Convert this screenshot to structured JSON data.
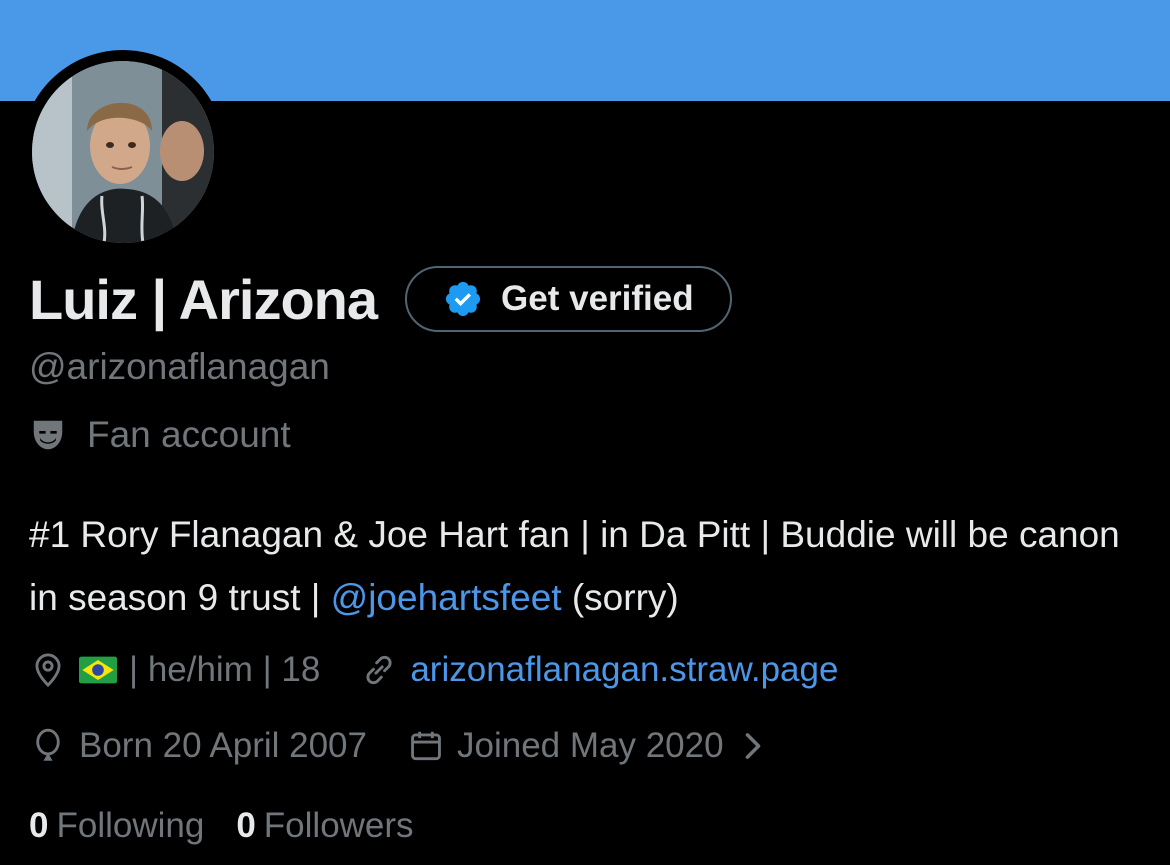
{
  "profile": {
    "name": "Luiz | Arizona",
    "handle": "@arizonaflanagan",
    "category": "Fan account",
    "get_verified_label": "Get verified",
    "bio": {
      "part1": "#1 Rory Flanagan & Joe Hart fan | in Da Pitt | Buddie will be canon in season 9 trust | ",
      "mention": "@joehartsfeet",
      "part2": " (sorry)"
    },
    "location": "| he/him | 18",
    "website": "arizonaflanagan.straw.page",
    "birthday": "Born 20 April 2007",
    "joined": "Joined May 2020",
    "following_count": "0",
    "following_label": "Following",
    "followers_count": "0",
    "followers_label": "Followers"
  },
  "colors": {
    "banner": "#4a99e9",
    "background": "#000000",
    "text_primary": "#e7e9ea",
    "text_secondary": "#71767b",
    "accent": "#4c97e8"
  },
  "icons": {
    "verified_badge": "verified-badge-icon",
    "category": "theater-mask-icon",
    "location": "location-pin-icon",
    "flag": "brazil-flag-icon",
    "link": "link-icon",
    "birthday": "balloon-icon",
    "calendar": "calendar-icon",
    "chevron": "chevron-right-icon"
  }
}
